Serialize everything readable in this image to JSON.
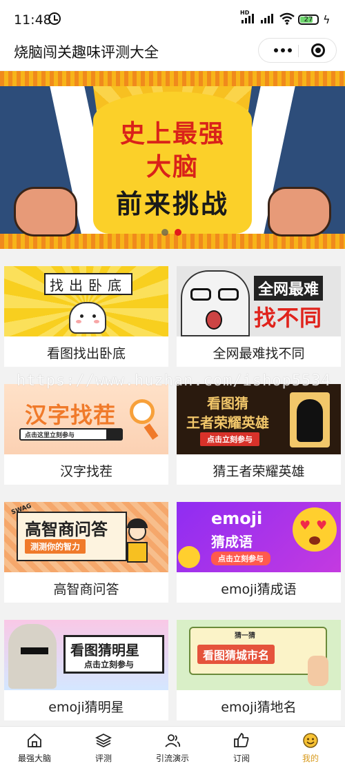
{
  "status_bar": {
    "time": "11:48",
    "network": "HD",
    "battery": "27"
  },
  "navbar": {
    "title": "烧脑闯关趣味评测大全"
  },
  "banner": {
    "line1": "史上最强",
    "line2": "大脑",
    "line3": "前来挑战",
    "dot_count": 2,
    "active_dot": 2
  },
  "cards": [
    {
      "label": "看图找出卧底",
      "image_text": "找出卧底"
    },
    {
      "label": "全网最难找不同",
      "image_text_1": "全网最难",
      "image_text_2": "找不同"
    },
    {
      "label": "汉字找茬",
      "image_text": "汉字找茬",
      "image_sub": "点击这里立刻参与"
    },
    {
      "label": "猜王者荣耀英雄",
      "image_text_1": "看图猜",
      "image_text_2": "王者荣耀英雄",
      "image_sub": "点击立刻参与"
    },
    {
      "label": "高智商问答",
      "image_text": "高智商问答",
      "image_sub": "测测你的智力",
      "badge": "SWAG"
    },
    {
      "label": "emoji猜成语",
      "image_text_1": "emoji",
      "image_text_2": "猜成语",
      "image_sub": "点击立刻参与"
    },
    {
      "label": "emoji猜明星",
      "image_text": "看图猜明星",
      "image_sub": "点击立刻参与"
    },
    {
      "label": "emoji猜地名",
      "image_top": "猜一猜",
      "image_text": "看图猜城市名"
    }
  ],
  "watermark": "https://www.huzhan.com/ishop5534",
  "tabs": [
    {
      "label": "最强大脑",
      "icon": "home-icon"
    },
    {
      "label": "评测",
      "icon": "layers-icon"
    },
    {
      "label": "引流演示",
      "icon": "users-icon"
    },
    {
      "label": "订阅",
      "icon": "thumbs-up-icon"
    },
    {
      "label": "我的",
      "icon": "smiley-icon",
      "active": true
    }
  ],
  "colors": {
    "accent": "#d89a1c",
    "banner_red": "#d9221a",
    "banner_yellow": "#f9c31a"
  }
}
